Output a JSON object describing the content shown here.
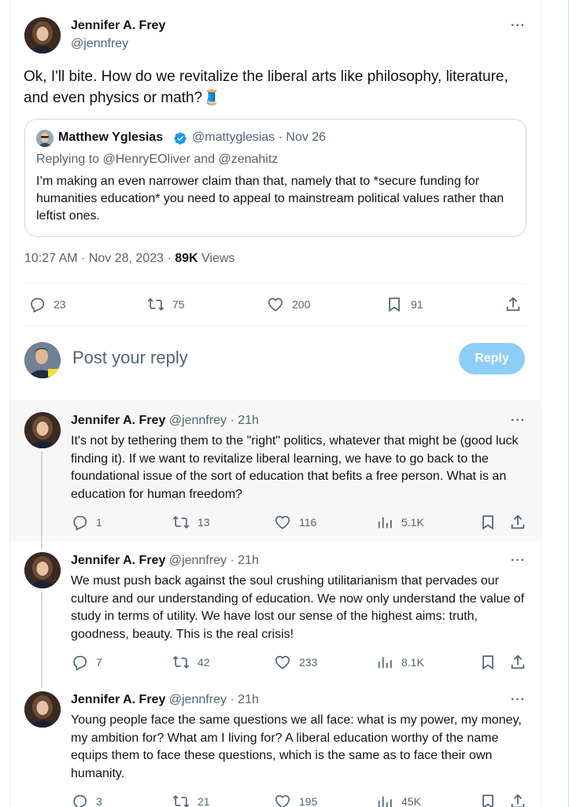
{
  "main_tweet": {
    "author_name": "Jennifer A. Frey",
    "author_handle": "@jennfrey",
    "more": "···",
    "text": "Ok, I'll bite. How do we revitalize the liberal arts like philosophy, literature, and even physics or math?🧵",
    "quote": {
      "author_name": "Matthew Yglesias",
      "author_handle": "@mattyglesias · Nov 26",
      "replying_to": "Replying to @HenryEOliver and @zenahitz",
      "text": "I’m making an even narrower claim than that, namely that to *secure funding for humanities education* you need to appeal to mainstream political values rather than leftist ones."
    },
    "timestamp": "10:27 AM · Nov 28, 2023 · ",
    "views_count": "89K",
    "views_label": " Views",
    "stats": {
      "replies": "23",
      "retweets": "75",
      "likes": "200",
      "bookmarks": "91"
    }
  },
  "reply_composer": {
    "placeholder": "Post your reply",
    "button_label": "Reply"
  },
  "thread": [
    {
      "author_name": "Jennifer A. Frey",
      "meta": "@jennfrey · 21h",
      "text": "It's not by tethering them to the \"right\" politics, whatever that might be (good luck finding it). If we want to revitalize liberal learning, we have to go back to the foundational issue of the sort of education that befits a free person. What is an education for human freedom?",
      "replies": "1",
      "retweets": "13",
      "likes": "116",
      "views": "5.1K"
    },
    {
      "author_name": "Jennifer A. Frey",
      "meta": "@jennfrey · 21h",
      "text": "We must push back against the soul crushing utilitarianism that pervades our culture and our understanding of education. We now only understand the value of study in terms of utility. We have lost our sense of the highest aims: truth, goodness, beauty. This is the real crisis!",
      "replies": "7",
      "retweets": "42",
      "likes": "233",
      "views": "8.1K"
    },
    {
      "author_name": "Jennifer A. Frey",
      "meta": "@jennfrey · 21h",
      "text": "Young people face the same questions we all face: what is my power, my money, my ambition for? What am I living for? A liberal education worthy of the name equips them to face these questions, which is the same as to face their own humanity.",
      "replies": "3",
      "retweets": "21",
      "likes": "195",
      "views": "45K"
    }
  ],
  "colors": {
    "accent": "#1d9bf0",
    "reply_button_disabled": "#8ecdf8",
    "secondary_text": "#536471",
    "highlight_bg": "#f7f7f7"
  }
}
